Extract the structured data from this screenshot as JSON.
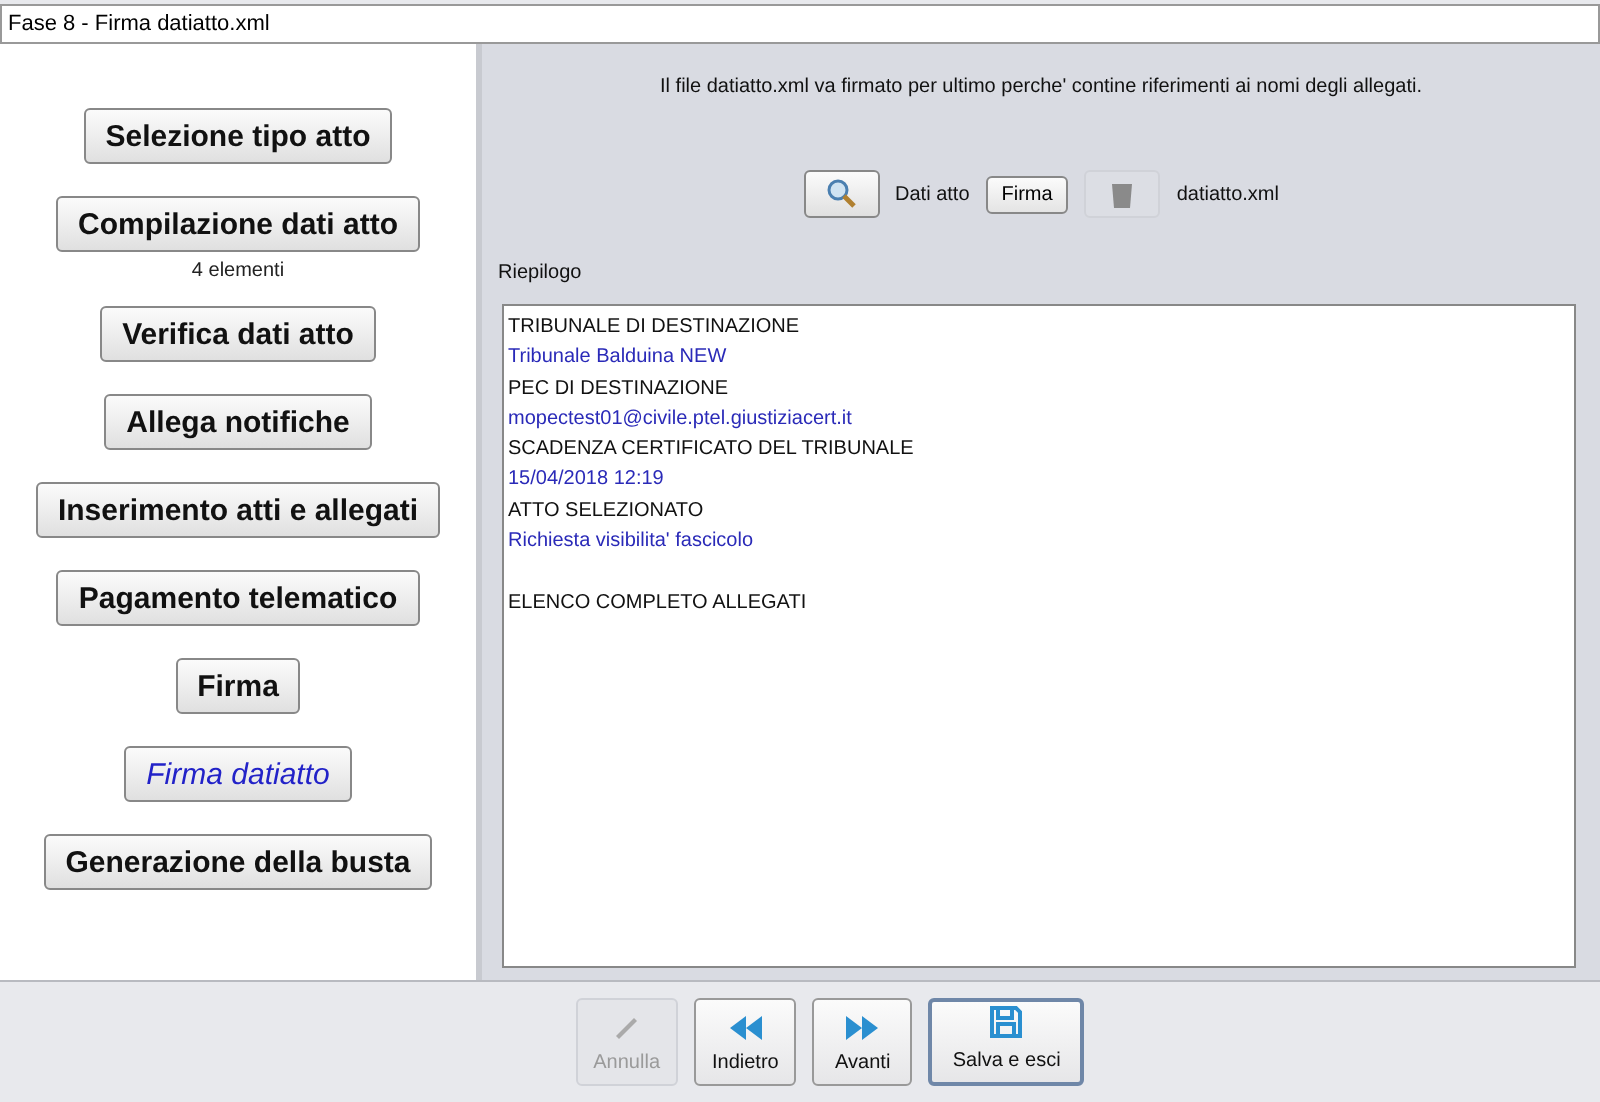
{
  "window": {
    "title": "Fase 8 - Firma datiatto.xml"
  },
  "steps": [
    {
      "label": "Selezione tipo atto",
      "selected": false
    },
    {
      "label": "Compilazione dati atto",
      "selected": false,
      "note": "4 elementi"
    },
    {
      "label": "Verifica dati atto",
      "selected": false
    },
    {
      "label": "Allega notifiche",
      "selected": false
    },
    {
      "label": "Inserimento atti e allegati",
      "selected": false
    },
    {
      "label": "Pagamento telematico",
      "selected": false
    },
    {
      "label": "Firma",
      "selected": false
    },
    {
      "label": "Firma datiatto",
      "selected": true
    },
    {
      "label": "Generazione della busta",
      "selected": false
    }
  ],
  "info": "Il file datiatto.xml va firmato per ultimo perche' contine riferimenti ai nomi degli allegati.",
  "file_row": {
    "label": "Dati atto",
    "sign_button": "Firma",
    "delete_disabled": true,
    "file_name": "datiatto.xml"
  },
  "summary": {
    "label": "Riepilogo",
    "lines": [
      {
        "kind": "heading",
        "text": "TRIBUNALE DI DESTINAZIONE"
      },
      {
        "kind": "value",
        "text": "Tribunale Balduina NEW"
      },
      {
        "kind": "heading",
        "text": "PEC DI DESTINAZIONE"
      },
      {
        "kind": "value",
        "text": "mopectest01@civile.ptel.giustiziacert.it"
      },
      {
        "kind": "heading",
        "text": "SCADENZA CERTIFICATO DEL TRIBUNALE"
      },
      {
        "kind": "value",
        "text": "15/04/2018 12:19"
      },
      {
        "kind": "heading",
        "text": "ATTO SELEZIONATO"
      },
      {
        "kind": "value",
        "text": "Richiesta visibilita' fascicolo"
      },
      {
        "kind": "blank"
      },
      {
        "kind": "heading",
        "text": "ELENCO COMPLETO ALLEGATI"
      }
    ]
  },
  "footer_buttons": [
    {
      "kind": "cancel",
      "label": "Annulla",
      "disabled": true,
      "focused": false
    },
    {
      "kind": "back",
      "label": "Indietro",
      "disabled": false,
      "focused": false
    },
    {
      "kind": "forward",
      "label": "Avanti",
      "disabled": false,
      "focused": false
    },
    {
      "kind": "save",
      "label": "Salva e esci",
      "disabled": false,
      "focused": true
    }
  ]
}
